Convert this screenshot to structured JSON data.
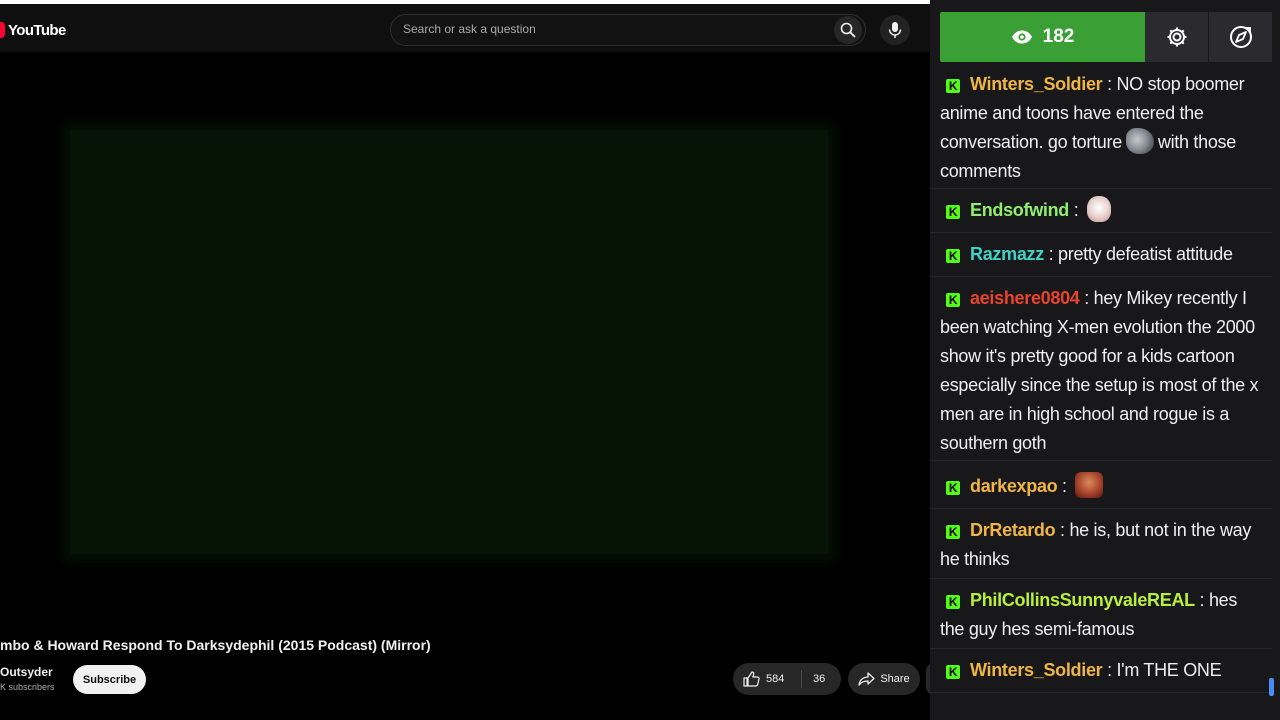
{
  "masthead": {
    "logo_text": "YouTube",
    "search_placeholder": "Search or ask a question"
  },
  "video": {
    "title": "mbo & Howard Respond To Darksydephil (2015 Podcast) (Mirror)",
    "channel": "Outsyder",
    "subscribers": "K subscribers",
    "subscribe_label": "Subscribe",
    "likes": "584",
    "dislikes": "36",
    "share_label": "Share"
  },
  "chat": {
    "viewer_count": "182",
    "messages": [
      {
        "user": "Winters_Soldier",
        "color": "#f0b545",
        "text_1": "NO stop boomer anime and toons have entered the conversation. go torture",
        "emote": "wolf-emote",
        "text_2": "with those comments"
      },
      {
        "user": "Endsofwind",
        "color": "#8ef06e",
        "emote": "hand-emote"
      },
      {
        "user": "Razmazz",
        "color": "#3fd3c3",
        "text_1": "pretty defeatist attitude"
      },
      {
        "user": "aeishere0804",
        "color": "#e8432e",
        "text_1": "hey Mikey recently I been watching X-men evolution the 2000 show it's pretty good for a kids cartoon especially since the setup is most of the x men are in high school and rogue is a southern goth"
      },
      {
        "user": "darkexpao",
        "color": "#f0b545",
        "emote": "face-emote"
      },
      {
        "user": "DrRetardo",
        "color": "#f0b545",
        "text_1": "he is, but not in the way he thinks"
      },
      {
        "user": "PhilCollinsSunnyvaleREAL",
        "color": "#b8f03a",
        "text_1": "hes the guy hes semi-famous"
      },
      {
        "user": "Winters_Soldier",
        "color": "#f0b545",
        "text_1": "I'm THE ONE"
      }
    ]
  }
}
